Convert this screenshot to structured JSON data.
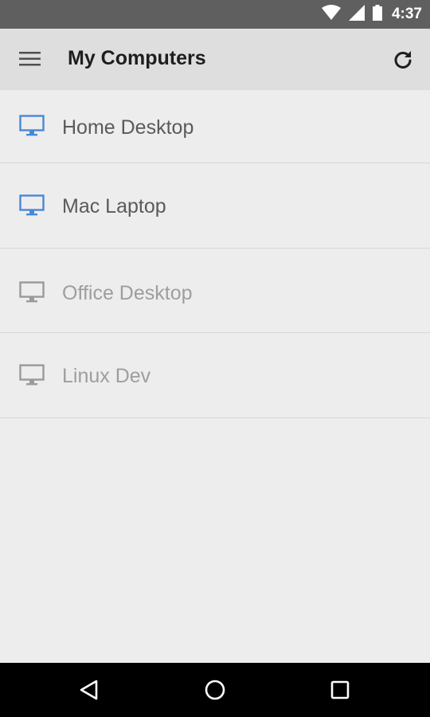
{
  "status_bar": {
    "time": "4:37",
    "icons": [
      "wifi-icon",
      "signal-icon",
      "battery-icon"
    ]
  },
  "toolbar": {
    "title": "My Computers",
    "menu_icon": "hamburger-menu-icon",
    "refresh_icon": "refresh-icon"
  },
  "computers": [
    {
      "name": "Home Desktop",
      "status": "online",
      "icon": "monitor-icon",
      "color": "#4a87d8"
    },
    {
      "name": "Mac Laptop",
      "status": "online",
      "icon": "monitor-icon",
      "color": "#4a87d8"
    },
    {
      "name": "Office Desktop",
      "status": "offline",
      "icon": "monitor-icon",
      "color": "#9a9a9a"
    },
    {
      "name": "Linux Dev",
      "status": "offline",
      "icon": "monitor-icon",
      "color": "#9a9a9a"
    }
  ],
  "nav_bar": {
    "buttons": [
      "back-icon",
      "home-icon",
      "recents-icon"
    ]
  },
  "colors": {
    "online_icon": "#4a87d8",
    "offline_icon": "#9a9a9a",
    "status_bar": "#5f5f5f",
    "toolbar": "#dedede",
    "background": "#ededed"
  }
}
